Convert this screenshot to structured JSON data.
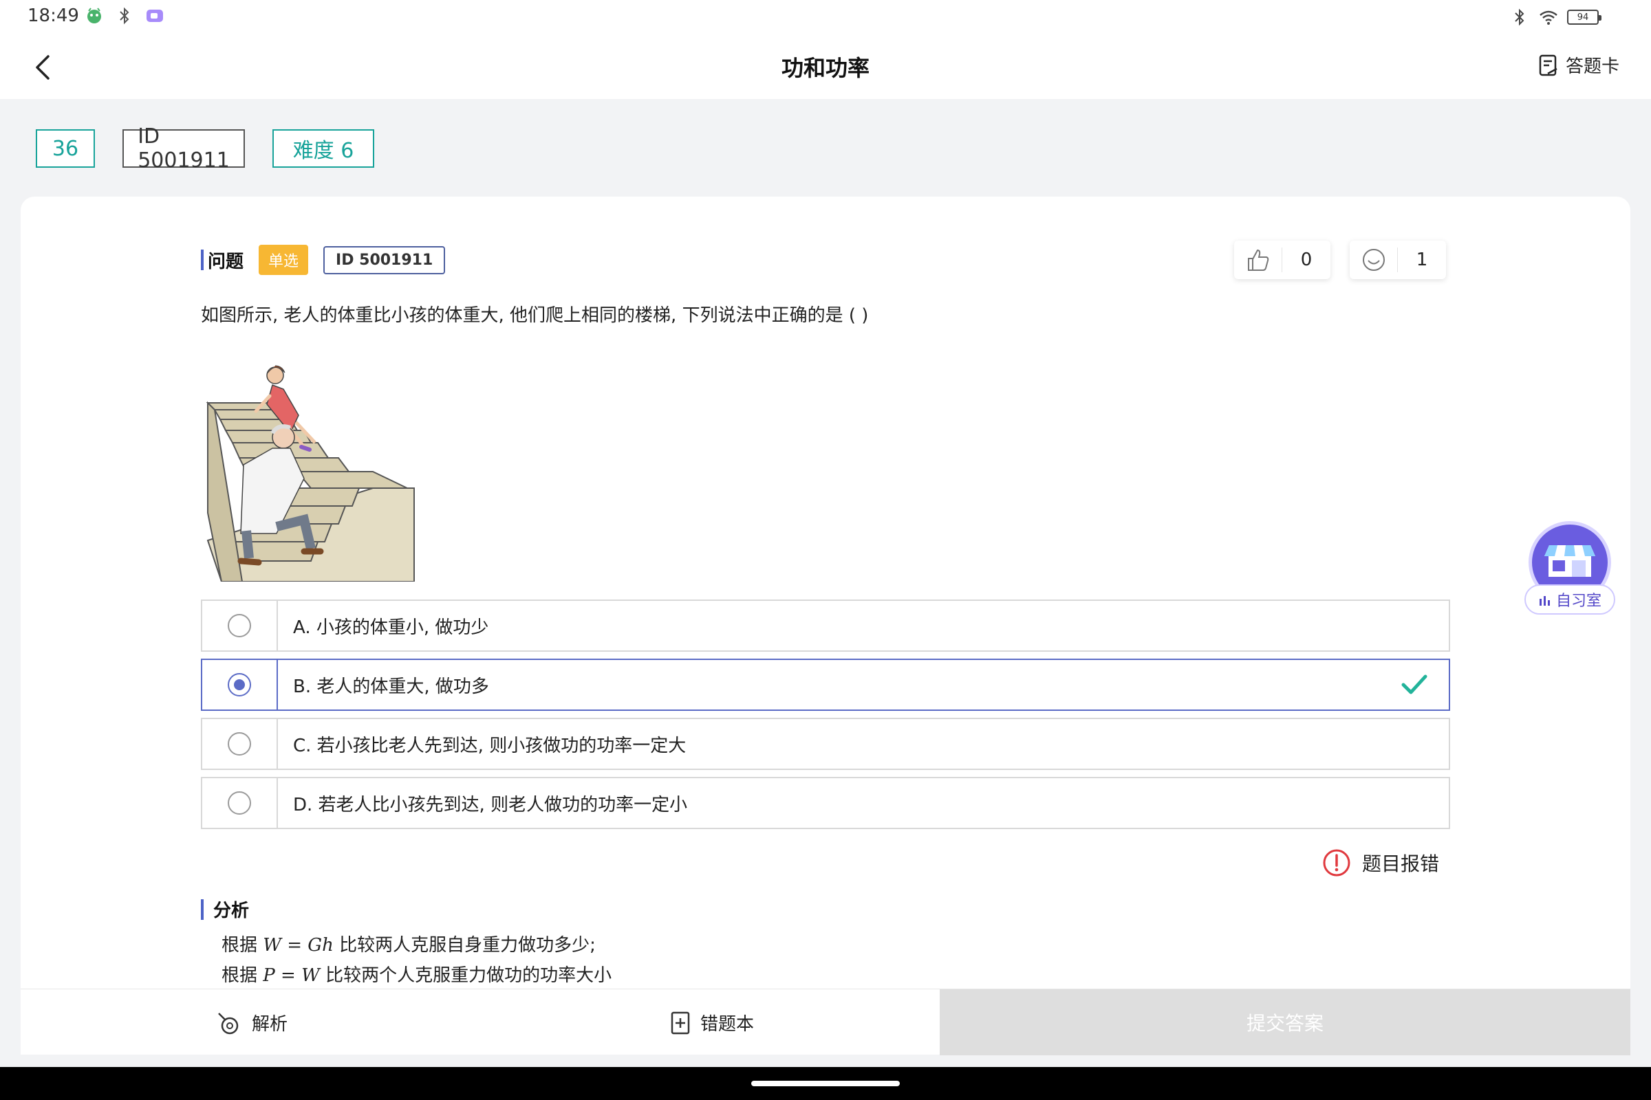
{
  "status_bar": {
    "time": "18:49",
    "battery": "94",
    "icons": [
      "app-icon",
      "bluetooth-icon",
      "screen-record-icon",
      "wifi-icon",
      "battery-icon"
    ]
  },
  "header": {
    "title": "功和功率",
    "answer_card_label": "答题卡"
  },
  "tags": {
    "number": "36",
    "id": "ID 5001911",
    "difficulty": "难度 6"
  },
  "question": {
    "section_label": "问题",
    "type_badge": "单选",
    "id_badge": "ID 5001911",
    "likes": "0",
    "reactions": "1",
    "text": "如图所示, 老人的体重比小孩的体重大, 他们爬上相同的楼梯, 下列说法中正确的是 (      )",
    "options": [
      {
        "label": "A. 小孩的体重小, 做功少",
        "selected": false
      },
      {
        "label": "B. 老人的体重大, 做功多",
        "selected": true
      },
      {
        "label": "C. 若小孩比老人先到达, 则小孩做功的功率一定大",
        "selected": false
      },
      {
        "label": "D. 若老人比小孩先到达, 则老人做功的功率一定小",
        "selected": false
      }
    ],
    "report_label": "题目报错"
  },
  "analysis": {
    "title": "分析",
    "line1_prefix": "根据 ",
    "line1_formula": "W = Gh",
    "line1_suffix": " 比较两人克服自身重力做功多少;",
    "line2_prefix": "根据 ",
    "line2_formula": "P = W",
    "line2_suffix": " 比较两个人克服重力做功的功率大小"
  },
  "bottom_bar": {
    "analysis_label": "解析",
    "wrong_book_label": "错题本",
    "submit_label": "提交答案"
  },
  "floating": {
    "study_room_label": "自习室"
  },
  "colors": {
    "accent_teal": "#18a39a",
    "accent_blue": "#5b6bc6",
    "badge_orange": "#f7b733",
    "report_red": "#e0393e",
    "check_green": "#22b39a"
  }
}
